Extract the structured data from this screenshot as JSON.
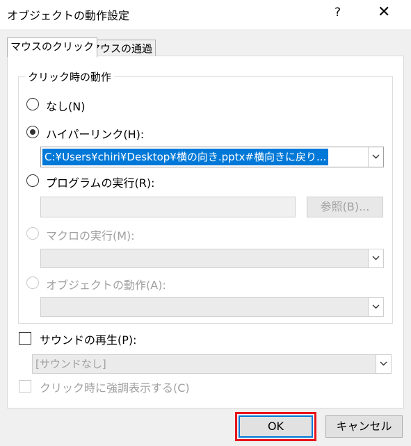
{
  "window": {
    "title": "オブジェクトの動作設定",
    "help": "?",
    "close": "✕"
  },
  "tabs": [
    {
      "label": "マウスのクリック"
    },
    {
      "label": "マウスの通過"
    }
  ],
  "group": {
    "title": "クリック時の動作",
    "options": {
      "none": "なし(N)",
      "hyperlink": "ハイパーリンク(H):",
      "program": "プログラムの実行(R):",
      "macro": "マクロの実行(M):",
      "object": "オブジェクトの動作(A):"
    },
    "hyperlink_value": "C:¥Users¥chiri¥Desktop¥横の向き.pptx#横向きに戻り...",
    "program_value": "",
    "browse_label": "参照(B)..."
  },
  "sound": {
    "label": "サウンドの再生(P):",
    "value": "[サウンドなし]"
  },
  "highlight_click": {
    "label": "クリック時に強調表示する(C)"
  },
  "buttons": {
    "ok": "OK",
    "cancel": "キャンセル"
  },
  "colors": {
    "selection": "#0078d7",
    "highlight_border": "#e8141c"
  }
}
